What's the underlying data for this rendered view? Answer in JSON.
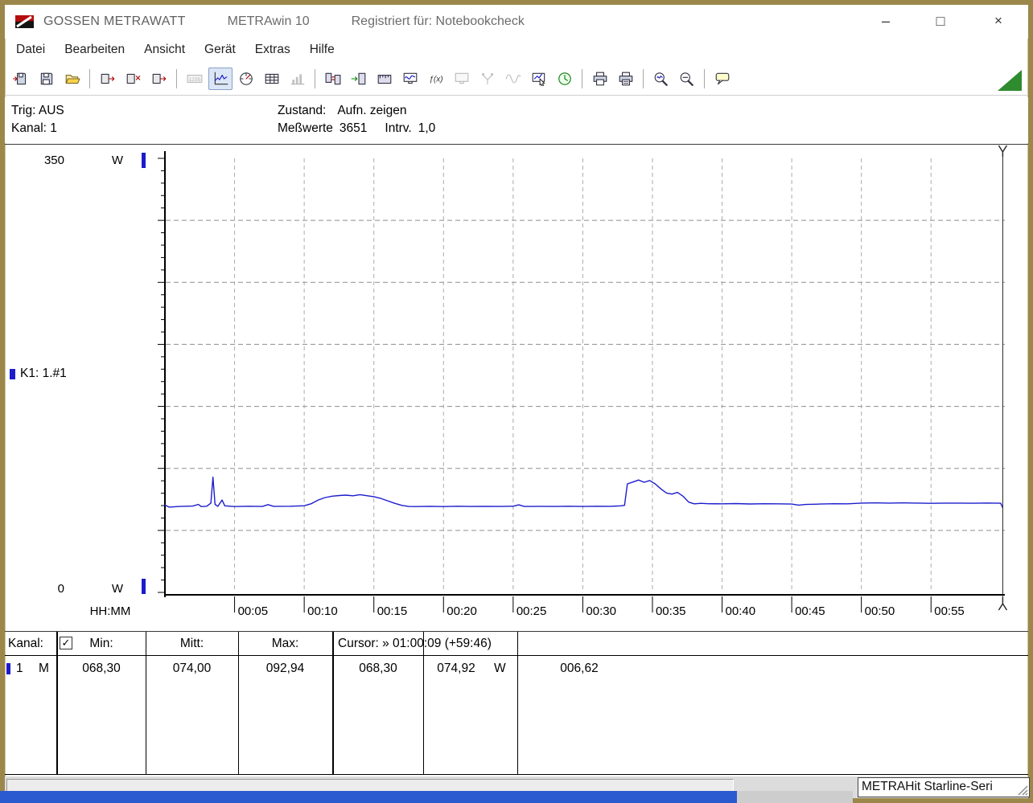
{
  "window": {
    "brand": "GOSSEN METRAWATT",
    "app": "METRAwin 10",
    "registered": "Registriert für: Notebookcheck",
    "controls": {
      "minimize": "–",
      "maximize": "□",
      "close": "×"
    }
  },
  "menu": {
    "items": [
      "Datei",
      "Bearbeiten",
      "Ansicht",
      "Gerät",
      "Extras",
      "Hilfe"
    ]
  },
  "toolbar": {
    "groups": [
      [
        {
          "name": "open-file-button",
          "icon": "floppyIn"
        },
        {
          "name": "save-file-button",
          "icon": "floppy"
        },
        {
          "name": "open-folder-button",
          "icon": "folder"
        }
      ],
      [
        {
          "name": "export-data-button",
          "icon": "cardOut"
        },
        {
          "name": "clear-memory-button",
          "icon": "cardX"
        },
        {
          "name": "send-data-button",
          "icon": "cardOut"
        }
      ],
      [
        {
          "name": "digital-display-button",
          "icon": "lcd",
          "state": "disabled"
        },
        {
          "name": "line-chart-view-button",
          "icon": "linechart",
          "state": "pressed"
        },
        {
          "name": "analog-meter-view-button",
          "icon": "meter"
        },
        {
          "name": "table-view-button",
          "icon": "grid"
        },
        {
          "name": "histogram-view-button",
          "icon": "hist",
          "state": "disabled"
        }
      ],
      [
        {
          "name": "device-transfer-button",
          "icon": "dev2"
        },
        {
          "name": "device-read-button",
          "icon": "devArrow"
        },
        {
          "name": "device-config-button",
          "icon": "devScale"
        },
        {
          "name": "online-display-button",
          "icon": "monitorWave"
        },
        {
          "name": "function-fx-button",
          "icon": "fx"
        },
        {
          "name": "offline-display-button",
          "icon": "monitor",
          "state": "disabled"
        },
        {
          "name": "channel-split-button",
          "icon": "branch",
          "state": "disabled"
        },
        {
          "name": "waveform-button",
          "icon": "wave2",
          "state": "disabled"
        },
        {
          "name": "annotate-chart-button",
          "icon": "handChart"
        },
        {
          "name": "timer-button",
          "icon": "clock"
        }
      ],
      [
        {
          "name": "print-button",
          "icon": "printer"
        },
        {
          "name": "print-setup-button",
          "icon": "printer2"
        }
      ],
      [
        {
          "name": "zoom-in-button",
          "icon": "zoomWave"
        },
        {
          "name": "zoom-out-button",
          "icon": "zoomMinus"
        }
      ],
      [
        {
          "name": "comment-button",
          "icon": "note"
        }
      ]
    ]
  },
  "status_panel": {
    "trig": "Trig: AUS",
    "kanal": "Kanal: 1",
    "zustand_label": "Zustand:",
    "zustand_value": "Aufn. zeigen",
    "messwerte_label": "Meßwerte",
    "messwerte_value": "3651",
    "intrv_label": "Intrv.",
    "intrv_value": "1,0"
  },
  "chart": {
    "channel_label": "K1: 1.#1"
  },
  "chart_data": {
    "type": "line",
    "x_axis_title": "HH:MM",
    "y_axis_unit": "W",
    "xlim_minutes": [
      0,
      60.3
    ],
    "ylim": [
      0,
      350
    ],
    "y_major_grid": 50,
    "y_tick_minor": 10,
    "x_grid_minutes": 5,
    "x_tick_labels": [
      "00:05",
      "00:10",
      "00:15",
      "00:20",
      "00:25",
      "00:30",
      "00:35",
      "00:40",
      "00:45",
      "00:50",
      "00:55"
    ],
    "cursor": {
      "x_minutes": 60.15,
      "time_label": "01:00:09",
      "offset_label": "+59:46",
      "value_w": 68.3,
      "mean_w": 74.92,
      "delta_w": 6.62
    },
    "series": [
      {
        "name": "K1: 1.#1",
        "color": "#1c1ccc",
        "unit": "W",
        "min": 68.3,
        "mean": 74.0,
        "max": 92.94,
        "x_minutes": [
          0,
          0.3,
          1,
          2,
          2.4,
          2.6,
          3,
          3.3,
          3.45,
          3.6,
          3.8,
          4.1,
          4.3,
          5,
          6,
          7,
          7.4,
          7.8,
          9,
          10,
          10.5,
          11,
          11.5,
          12,
          12.5,
          13,
          13.5,
          14,
          14.5,
          15,
          15.5,
          16,
          16.5,
          17,
          17.5,
          18,
          19,
          20,
          21,
          22,
          23,
          24,
          25,
          25.4,
          25.8,
          27,
          28,
          29,
          30,
          31,
          32,
          32.7,
          33,
          33.2,
          33.6,
          34,
          34.4,
          34.8,
          35.2,
          35.6,
          36,
          36.4,
          36.8,
          37.2,
          37.6,
          38,
          38.5,
          39,
          40,
          41,
          42,
          43,
          44,
          45,
          45.5,
          46,
          47,
          48,
          49,
          50,
          51,
          52,
          53,
          54,
          55,
          56,
          57,
          58,
          59,
          60,
          60.15
        ],
        "values": [
          70.5,
          68.8,
          69.3,
          69.6,
          71.0,
          69.2,
          69.5,
          72.0,
          92.9,
          71.0,
          69.4,
          74.5,
          69.8,
          69.2,
          69.5,
          69.3,
          70.8,
          69.4,
          69.5,
          69.9,
          71.5,
          74.5,
          76.5,
          77.6,
          78.1,
          78.4,
          77.9,
          78.8,
          78.0,
          77.2,
          75.8,
          73.8,
          71.8,
          70.2,
          69.3,
          69.2,
          69.4,
          69.2,
          69.5,
          69.3,
          69.4,
          69.3,
          69.5,
          70.6,
          69.3,
          69.4,
          69.3,
          69.5,
          69.3,
          69.5,
          69.4,
          69.8,
          70.2,
          87.5,
          89.0,
          90.6,
          88.8,
          90.2,
          87.5,
          83.5,
          80.2,
          79.3,
          80.6,
          77.5,
          72.8,
          71.4,
          71.8,
          71.5,
          71.4,
          71.6,
          71.3,
          71.5,
          71.4,
          71.2,
          70.4,
          70.9,
          71.2,
          71.5,
          71.4,
          72.0,
          72.2,
          72.0,
          72.2,
          72.0,
          71.8,
          72.0,
          72.0,
          71.9,
          72.1,
          71.9,
          68.3
        ]
      }
    ]
  },
  "stats_table": {
    "headers": {
      "kanal": "Kanal:",
      "min": "Min:",
      "mitt": "Mitt:",
      "max": "Max:",
      "cursor": "Cursor: » 01:00:09 (+59:46)"
    },
    "checkbox_glyph": "✓",
    "row": {
      "channel": "1",
      "flag": "M",
      "min": "068,30",
      "mitt": "074,00",
      "max": "092,94",
      "cursor_value": "068,30",
      "cursor_mean": "074,92",
      "unit": "W",
      "cursor_delta": "006,62"
    }
  },
  "statusbar": {
    "device": "METRAHit Starline-Seri"
  }
}
